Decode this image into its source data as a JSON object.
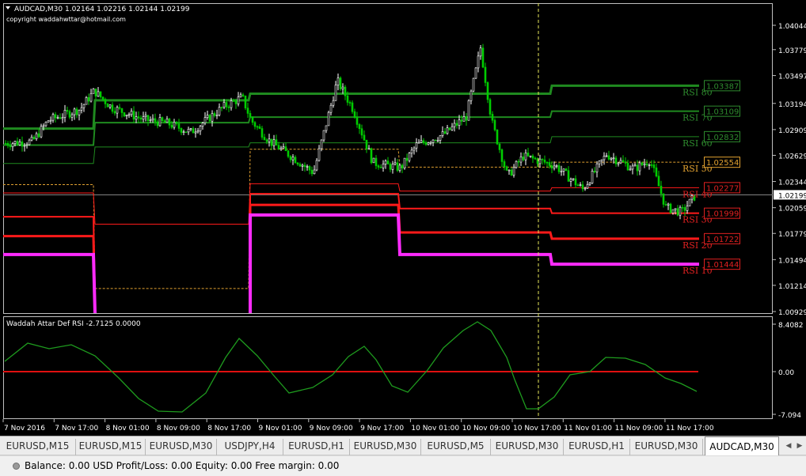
{
  "chart": {
    "header": {
      "symbol_line": "AUDCAD,M30  1.02164 1.02216 1.02144 1.02199",
      "copyright": "copyright waddahwttar@hotmail.com"
    },
    "menu_arrow_icon": "triangle-down-icon",
    "price_axis": {
      "ticks": [
        "1.04044",
        "1.03779",
        "1.03497",
        "1.03194",
        "1.02909",
        "1.02629",
        "1.02344",
        "1.02059",
        "1.01779",
        "1.01494",
        "1.01214",
        "1.00929"
      ],
      "current_price": "1.02199"
    },
    "level_labels": [
      {
        "rsi": "RSI 80",
        "price": "1.03387",
        "color": "#2e8b2e"
      },
      {
        "rsi": "RSI 70",
        "price": "1.03109",
        "color": "#2e8b2e"
      },
      {
        "rsi": "RSI 60",
        "price": "1.02832",
        "color": "#2e8b2e"
      },
      {
        "rsi": "RSI 50",
        "price": "1.02554",
        "color": "#e0a030"
      },
      {
        "rsi": "RSI 40",
        "price": "1.02277",
        "color": "#e02020"
      },
      {
        "rsi": "RSI 30",
        "price": "1.01999",
        "color": "#e02020"
      },
      {
        "rsi": "RSI 20",
        "price": "1.01722",
        "color": "#e02020"
      },
      {
        "rsi": "RSI 10",
        "price": "1.01444",
        "color": "#e02020"
      }
    ],
    "indicator": {
      "title": "Waddah Attar Def RSI -2.7125 0.0000",
      "ticks": [
        "8.4082",
        "0.00",
        "-7.094"
      ]
    },
    "time_axis": [
      "7 Nov 2016",
      "7 Nov 17:00",
      "8 Nov 01:00",
      "8 Nov 09:00",
      "8 Nov 17:00",
      "9 Nov 01:00",
      "9 Nov 09:00",
      "9 Nov 17:00",
      "10 Nov 01:00",
      "10 Nov 09:00",
      "10 Nov 17:00",
      "11 Nov 01:00",
      "11 Nov 09:00",
      "11 Nov 17:00"
    ],
    "colors": {
      "background": "#000000",
      "bull_candle": "#ffffff",
      "bear_candle": "#00cc00",
      "level_green": "#1f8a1f",
      "level_red": "#ff1a1a",
      "level_magenta": "#ff2bff",
      "indicator_line": "#1e9b1e",
      "zero_line": "#e01010",
      "crosshair": "#e6e65a"
    }
  },
  "tabs": {
    "items": [
      "EURUSD,M15",
      "EURUSD,M15",
      "EURUSD,M30",
      "USDJPY,H4",
      "EURUSD,H1",
      "EURUSD,M30",
      "EURUSD,M5",
      "EURUSD,M30",
      "EURUSD,H1",
      "EURUSD,M30",
      "AUDCAD,M30"
    ],
    "active_index": 10,
    "scroll_left_icon": "arrow-left-icon",
    "scroll_right_icon": "arrow-right-icon"
  },
  "status": {
    "icon": "status-dot-icon",
    "text": "Balance: 0.00 USD  Profit/Loss: 0.00  Equity: 0.00  Free margin: 0.00"
  }
}
